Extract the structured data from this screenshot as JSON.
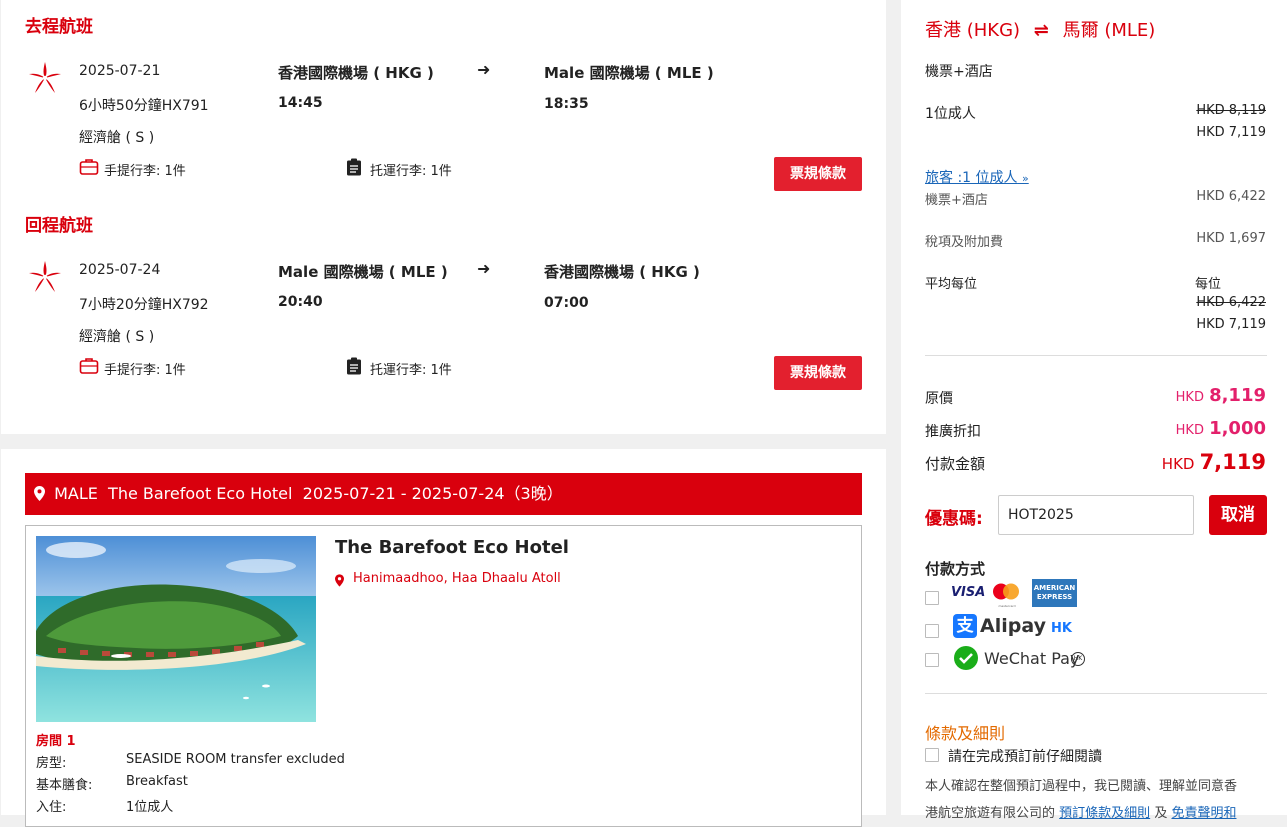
{
  "outbound": {
    "title": "去程航班",
    "date": "2025-07-21",
    "duration_flight": "6小時50分鐘HX791",
    "cabin": "經濟艙 ( S )",
    "from_airport": "香港國際機場 ( HKG )",
    "from_time": "14:45",
    "to_airport": "Male 國際機場 ( MLE )",
    "to_time": "18:35",
    "carry_on": "手提行李: 1件",
    "checked": "托運行李: 1件",
    "rules_button": "票規條款"
  },
  "inbound": {
    "title": "回程航班",
    "date": "2025-07-24",
    "duration_flight": "7小時20分鐘HX792",
    "cabin": "經濟艙 ( S )",
    "from_airport": "Male 國際機場 ( MLE )",
    "from_time": "20:40",
    "to_airport": "香港國際機場 ( HKG )",
    "to_time": "07:00",
    "carry_on": "手提行李: 1件",
    "checked": "托運行李: 1件",
    "rules_button": "票規條款"
  },
  "hotel": {
    "banner": "MALE  The Barefoot Eco Hotel  2025-07-21 - 2025-07-24（3晚）",
    "name": "The Barefoot Eco Hotel",
    "location": "Hanimaadhoo, Haa Dhaalu Atoll",
    "room_title": "房間 1",
    "room_type_label": "房型:",
    "room_type_value": "SEASIDE ROOM transfer excluded",
    "meal_label": "基本膳食:",
    "meal_value": "Breakfast",
    "guests_label": "入住:",
    "guests_value": "1位成人"
  },
  "summary": {
    "route_from": "香港 (HKG)",
    "route_arrow": "⇌",
    "route_to": "馬爾 (MLE)",
    "package": "機票+酒店",
    "adult_label": "1位成人",
    "adult_original": "HKD 8,119",
    "adult_price": "HKD 7,119",
    "travellers_link": "旅客 :1 位成人",
    "pkg_label": "機票+酒店",
    "pkg_price": "HKD 6,422",
    "tax_label": "稅項及附加費",
    "tax_price": "HKD 1,697",
    "avg_label": "平均每位",
    "avg_each": "每位",
    "avg_original": "HKD 6,422",
    "avg_price": "HKD 7,119",
    "orig_label": "原價",
    "orig_cur": "HKD",
    "orig_amount": "8,119",
    "promo_label": "推廣折扣",
    "promo_cur": "HKD",
    "promo_amount": "1,000",
    "pay_label": "付款金額",
    "pay_cur": "HKD",
    "pay_amount": "7,119",
    "coupon_label": "優惠碼:",
    "coupon_value": "HOT2025",
    "cancel_button": "取消",
    "payment_title": "付款方式",
    "visa": "VISA",
    "mastercard_text": "mastercard",
    "amex_line1": "AMERICAN",
    "amex_line2": "EXPRESS",
    "alipay": "Alipay",
    "alipay_hk": "HK",
    "wechat": "WeChat Pay",
    "terms_title": "條款及細則",
    "terms_check": "請在完成預訂前仔細閱讀",
    "terms_text": "本人確認在整個預訂過程中，我已閱讀、理解並同意香",
    "terms_text2": "港航空旅遊有限公司的",
    "terms_link1": "預訂條款及細則",
    "terms_and": "及",
    "terms_link2": "免責聲明和"
  },
  "colors": {
    "brand_red": "#d9000d",
    "button_red": "#e3202e",
    "price_pink": "#e3206b",
    "link_blue": "#1a66b8"
  }
}
